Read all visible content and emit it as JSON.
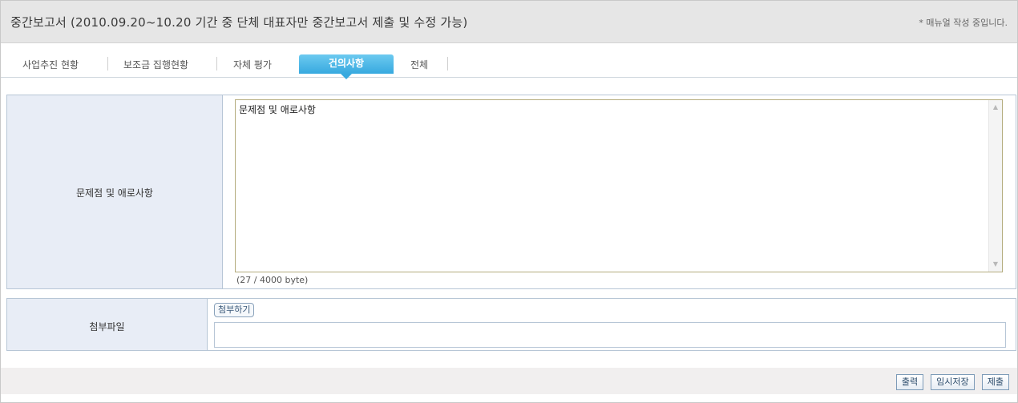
{
  "header": {
    "title": "중간보고서 (2010.09.20~10.20 기간 중 단체 대표자만 중간보고서 제출 및 수정 가능)",
    "notice": "* 매뉴얼 작성 중입니다."
  },
  "tabs": [
    {
      "label": "사업추진 현황",
      "active": false
    },
    {
      "label": "보조금 집행현황",
      "active": false
    },
    {
      "label": "자체 평가",
      "active": false
    },
    {
      "label": "건의사항",
      "active": true
    },
    {
      "label": "전체",
      "active": false
    }
  ],
  "issues": {
    "label": "문제점 및 애로사항",
    "value": "문제점 및 애로사항",
    "byte_count": "(27 / 4000 byte)"
  },
  "attachment": {
    "label": "첨부파일",
    "attach_button": "첨부하기",
    "file_value": ""
  },
  "actions": {
    "print": "출력",
    "temp_save": "임시저장",
    "submit": "제출"
  },
  "colors": {
    "active_tab": "#37a9df",
    "label_cell_bg": "#e8edf6",
    "border": "#b7c6d6"
  }
}
